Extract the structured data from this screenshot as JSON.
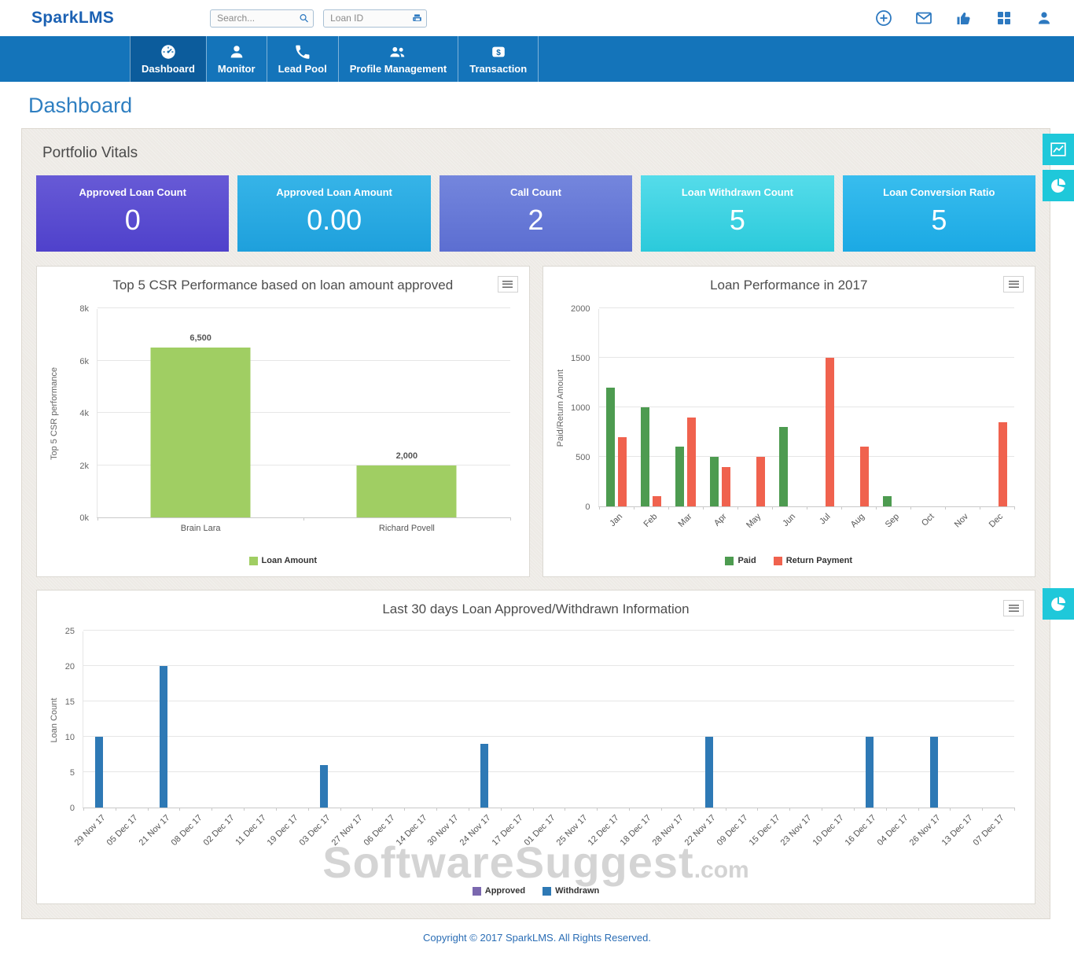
{
  "header": {
    "logo": "SparkLMS",
    "search": {
      "placeholder": "Search..."
    },
    "loan_id": {
      "placeholder": "Loan ID"
    },
    "icons": [
      "add-circle-icon",
      "mail-icon",
      "thumbs-up-icon",
      "apps-grid-icon",
      "user-icon"
    ]
  },
  "nav": {
    "items": [
      {
        "label": "Dashboard",
        "icon": "dashboard-gauge-icon",
        "active": true
      },
      {
        "label": "Monitor",
        "icon": "person-icon",
        "active": false
      },
      {
        "label": "Lead Pool",
        "icon": "phone-icon",
        "active": false
      },
      {
        "label": "Profile Management",
        "icon": "people-group-icon",
        "active": false
      },
      {
        "label": "Transaction",
        "icon": "money-icon",
        "active": false
      }
    ]
  },
  "page": {
    "title": "Dashboard",
    "section_title": "Portfolio Vitals"
  },
  "stat_cards": [
    {
      "label": "Approved Loan Count",
      "value": "0",
      "color_top": "#675ad6",
      "color_bottom": "#4f41cb"
    },
    {
      "label": "Approved Loan Amount",
      "value": "0.00",
      "color_top": "#36b4e8",
      "color_bottom": "#1ea0dc"
    },
    {
      "label": "Call Count",
      "value": "2",
      "color_top": "#7486dd",
      "color_bottom": "#5c6ed1"
    },
    {
      "label": "Loan Withdrawn Count",
      "value": "5",
      "color_top": "#55dcea",
      "color_bottom": "#2bcadb"
    },
    {
      "label": "Loan Conversion Ratio",
      "value": "5",
      "color_top": "#38bdee",
      "color_bottom": "#1ba9e4"
    }
  ],
  "chart_data": [
    {
      "id": "csr",
      "type": "bar",
      "title": "Top 5 CSR Performance based on loan amount approved",
      "categories": [
        "Brain Lara",
        "Richard Povell"
      ],
      "series": [
        {
          "name": "Loan Amount",
          "color": "#a0ce63",
          "values": [
            6500,
            2000
          ]
        }
      ],
      "data_labels": [
        "6,500",
        "2,000"
      ],
      "ylabel": "Top 5 CSR performance",
      "ylim": [
        0,
        8000
      ],
      "yticks": [
        0,
        2000,
        4000,
        6000,
        8000
      ],
      "ytick_labels": [
        "0k",
        "2k",
        "4k",
        "6k",
        "8k"
      ],
      "legend_position": "bottom"
    },
    {
      "id": "performance2017",
      "type": "bar",
      "title": "Loan Performance in 2017",
      "categories": [
        "Jan",
        "Feb",
        "Mar",
        "Apr",
        "May",
        "Jun",
        "Jul",
        "Aug",
        "Sep",
        "Oct",
        "Nov",
        "Dec"
      ],
      "series": [
        {
          "name": "Paid",
          "color": "#4d9b50",
          "values": [
            1200,
            1000,
            600,
            500,
            0,
            800,
            0,
            0,
            100,
            0,
            0,
            0
          ]
        },
        {
          "name": "Return Payment",
          "color": "#f0624e",
          "values": [
            700,
            100,
            900,
            400,
            500,
            0,
            1500,
            600,
            0,
            0,
            0,
            850
          ]
        }
      ],
      "ylabel": "Paid/Return Amount",
      "ylim": [
        0,
        2000
      ],
      "yticks": [
        0,
        500,
        1000,
        1500,
        2000
      ],
      "ytick_labels": [
        "0",
        "500",
        "1000",
        "1500",
        "2000"
      ],
      "legend_position": "bottom"
    },
    {
      "id": "last30",
      "type": "bar",
      "title": "Last 30 days Loan Approved/Withdrawn Information",
      "categories": [
        "29 Nov 17",
        "05 Dec 17",
        "21 Nov 17",
        "08 Dec 17",
        "02 Dec 17",
        "11 Dec 17",
        "19 Dec 17",
        "03 Dec 17",
        "27 Nov 17",
        "06 Dec 17",
        "14 Dec 17",
        "30 Nov 17",
        "24 Nov 17",
        "17 Dec 17",
        "01 Dec 17",
        "25 Nov 17",
        "12 Dec 17",
        "18 Dec 17",
        "28 Nov 17",
        "22 Nov 17",
        "09 Dec 17",
        "15 Dec 17",
        "23 Nov 17",
        "10 Dec 17",
        "16 Dec 17",
        "04 Dec 17",
        "26 Nov 17",
        "13 Dec 17",
        "07 Dec 17"
      ],
      "series": [
        {
          "name": "Approved",
          "color": "#7b68af",
          "values": [
            0,
            0,
            0,
            0,
            0,
            0,
            0,
            0,
            0,
            0,
            0,
            0,
            0,
            0,
            0,
            0,
            0,
            0,
            0,
            0,
            0,
            0,
            0,
            0,
            0,
            0,
            0,
            0,
            0
          ]
        },
        {
          "name": "Withdrawn",
          "color": "#2e79b5",
          "values": [
            10,
            0,
            20,
            0,
            0,
            0,
            0,
            6,
            0,
            0,
            0,
            0,
            9,
            0,
            0,
            0,
            0,
            0,
            0,
            10,
            0,
            0,
            0,
            0,
            10,
            0,
            10,
            0,
            0
          ]
        }
      ],
      "ylabel": "Loan Count",
      "ylim": [
        0,
        25
      ],
      "yticks": [
        0,
        5,
        10,
        15,
        20,
        25
      ],
      "ytick_labels": [
        "0",
        "5",
        "10",
        "15",
        "20",
        "25"
      ],
      "legend_position": "bottom"
    }
  ],
  "side_buttons": [
    {
      "icon": "line-chart-icon"
    },
    {
      "icon": "pie-chart-icon"
    },
    {
      "icon": "pie-chart-icon"
    }
  ],
  "watermark": {
    "text": "SoftwareSuggest",
    "suffix": ".com"
  },
  "footer": {
    "text": "Copyright © 2017 SparkLMS. All Rights Reserved."
  }
}
